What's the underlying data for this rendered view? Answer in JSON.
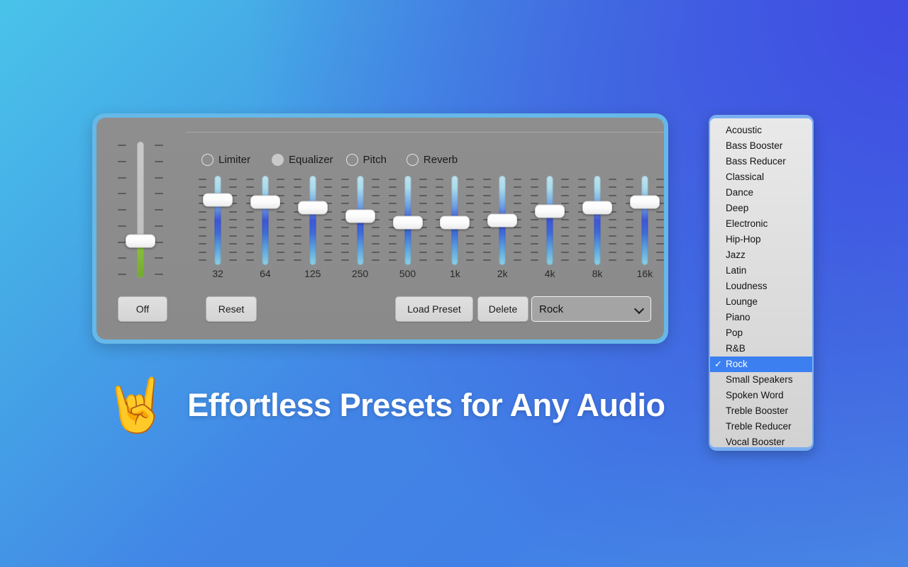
{
  "theme": {
    "bg_gradient_start": "#49c3ea",
    "bg_gradient_end": "#404fdd",
    "panel_border": "#66b8e8",
    "panel_bg": "#8c8c8c",
    "accent_selected": "#3b7ff0",
    "master_fill": "#8cc63f"
  },
  "headline": {
    "emoji": "🤘",
    "emoji_name": "sign-of-the-horns",
    "text": "Effortless Presets for Any Audio"
  },
  "equalizer_panel": {
    "master": {
      "label": "Off",
      "value_percent": 28,
      "tick_count": 9
    },
    "modes": [
      {
        "label": "Limiter",
        "selected": false
      },
      {
        "label": "Equalizer",
        "selected": true
      },
      {
        "label": "Pitch",
        "selected": false
      },
      {
        "label": "Reverb",
        "selected": false
      }
    ],
    "buttons": {
      "off": "Off",
      "reset": "Reset",
      "load_preset": "Load Preset",
      "delete": "Delete"
    },
    "preset_select": {
      "value": "Rock",
      "chevron_icon": "chevron-down-icon"
    },
    "bands": [
      {
        "label": "32",
        "gain_percent": 72
      },
      {
        "label": "64",
        "gain_percent": 70
      },
      {
        "label": "125",
        "gain_percent": 64
      },
      {
        "label": "250",
        "gain_percent": 55
      },
      {
        "label": "500",
        "gain_percent": 48
      },
      {
        "label": "1k",
        "gain_percent": 48
      },
      {
        "label": "2k",
        "gain_percent": 50
      },
      {
        "label": "4k",
        "gain_percent": 60
      },
      {
        "label": "8k",
        "gain_percent": 64
      },
      {
        "label": "16k",
        "gain_percent": 70
      }
    ]
  },
  "preset_menu": {
    "selected": "Rock",
    "check_icon": "checkmark-icon",
    "items": [
      "Acoustic",
      "Bass Booster",
      "Bass Reducer",
      "Classical",
      "Dance",
      "Deep",
      "Electronic",
      "Hip-Hop",
      "Jazz",
      "Latin",
      "Loudness",
      "Lounge",
      "Piano",
      "Pop",
      "R&B",
      "Rock",
      "Small Speakers",
      "Spoken Word",
      "Treble Booster",
      "Treble Reducer",
      "Vocal Booster"
    ]
  }
}
